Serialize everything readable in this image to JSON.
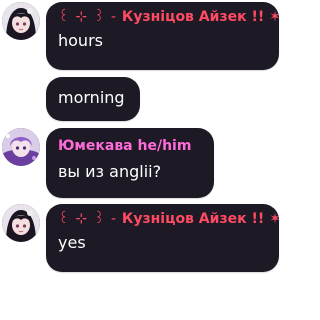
{
  "chat": {
    "groups": [
      {
        "sender": {
          "decoration": "꒰ ⊹ ꒱ -",
          "name": "Кузніцов Айзек !!",
          "suffix": "✶",
          "color": "#ff4a63"
        },
        "messages": [
          {
            "text": "hours"
          },
          {
            "text": "morning"
          }
        ]
      },
      {
        "sender": {
          "decoration": "",
          "name": "Юмекава he/him",
          "suffix": "",
          "color": "#ff6bd8"
        },
        "messages": [
          {
            "text": "вы из anglii?"
          }
        ]
      },
      {
        "sender": {
          "decoration": "꒰ ⊹ ꒱ -",
          "name": "Кузніцов Айзек !!",
          "suffix": "✶",
          "color": "#ff4a63"
        },
        "messages": [
          {
            "text": "yes"
          }
        ]
      }
    ]
  },
  "theme": {
    "bubble_background": "#1d1a26",
    "page_background": "#ffffff",
    "text_color": "#ffffff"
  },
  "icons": {
    "avatar_1": "anime-girl-avatar-icon",
    "avatar_2": "anime-boy-purple-avatar-icon"
  }
}
